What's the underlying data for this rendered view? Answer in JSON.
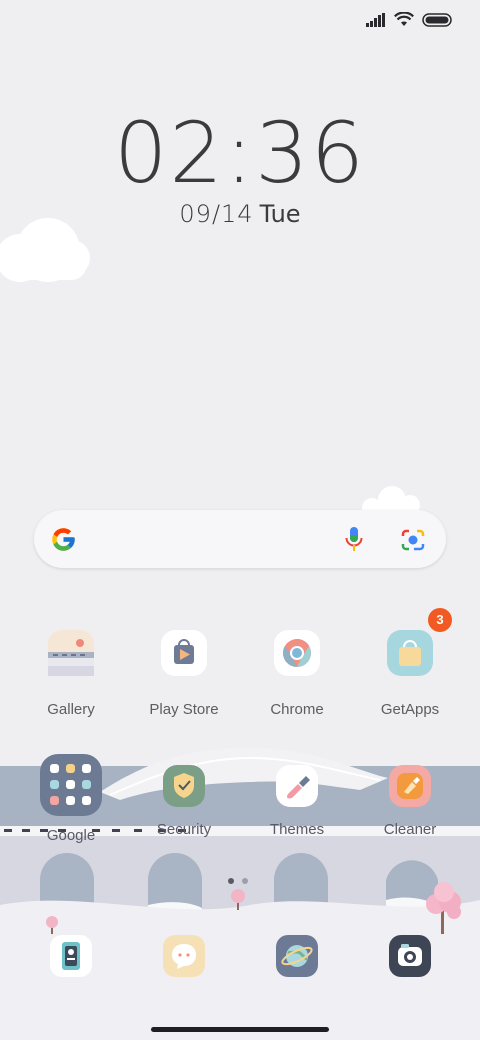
{
  "status_bar": {
    "icons": [
      "signal-icon",
      "wifi-icon",
      "battery-icon"
    ]
  },
  "clock": {
    "time": "02:36",
    "date": "09/14",
    "weekday": "Tue"
  },
  "search_bar": {
    "icons": [
      "google-logo-icon",
      "microphone-icon",
      "lens-camera-icon"
    ]
  },
  "apps_row1": [
    {
      "label": "Gallery",
      "icon": "gallery-icon"
    },
    {
      "label": "Play Store",
      "icon": "play-store-icon"
    },
    {
      "label": "Chrome",
      "icon": "chrome-icon"
    },
    {
      "label": "GetApps",
      "icon": "getapps-icon",
      "badge": "3"
    }
  ],
  "apps_row2": [
    {
      "label": "Google",
      "icon": "google-folder-icon"
    },
    {
      "label": "Security",
      "icon": "security-icon"
    },
    {
      "label": "Themes",
      "icon": "themes-icon"
    },
    {
      "label": "Cleaner",
      "icon": "cleaner-icon"
    }
  ],
  "page_indicator": {
    "pages": 2,
    "current": 1
  },
  "dock": [
    {
      "icon": "phone-icon"
    },
    {
      "icon": "messaging-icon"
    },
    {
      "icon": "browser-icon"
    },
    {
      "icon": "camera-icon"
    }
  ],
  "colors": {
    "background": "#efeef1",
    "badge": "#f15a22",
    "text": "#3b3b3f"
  }
}
